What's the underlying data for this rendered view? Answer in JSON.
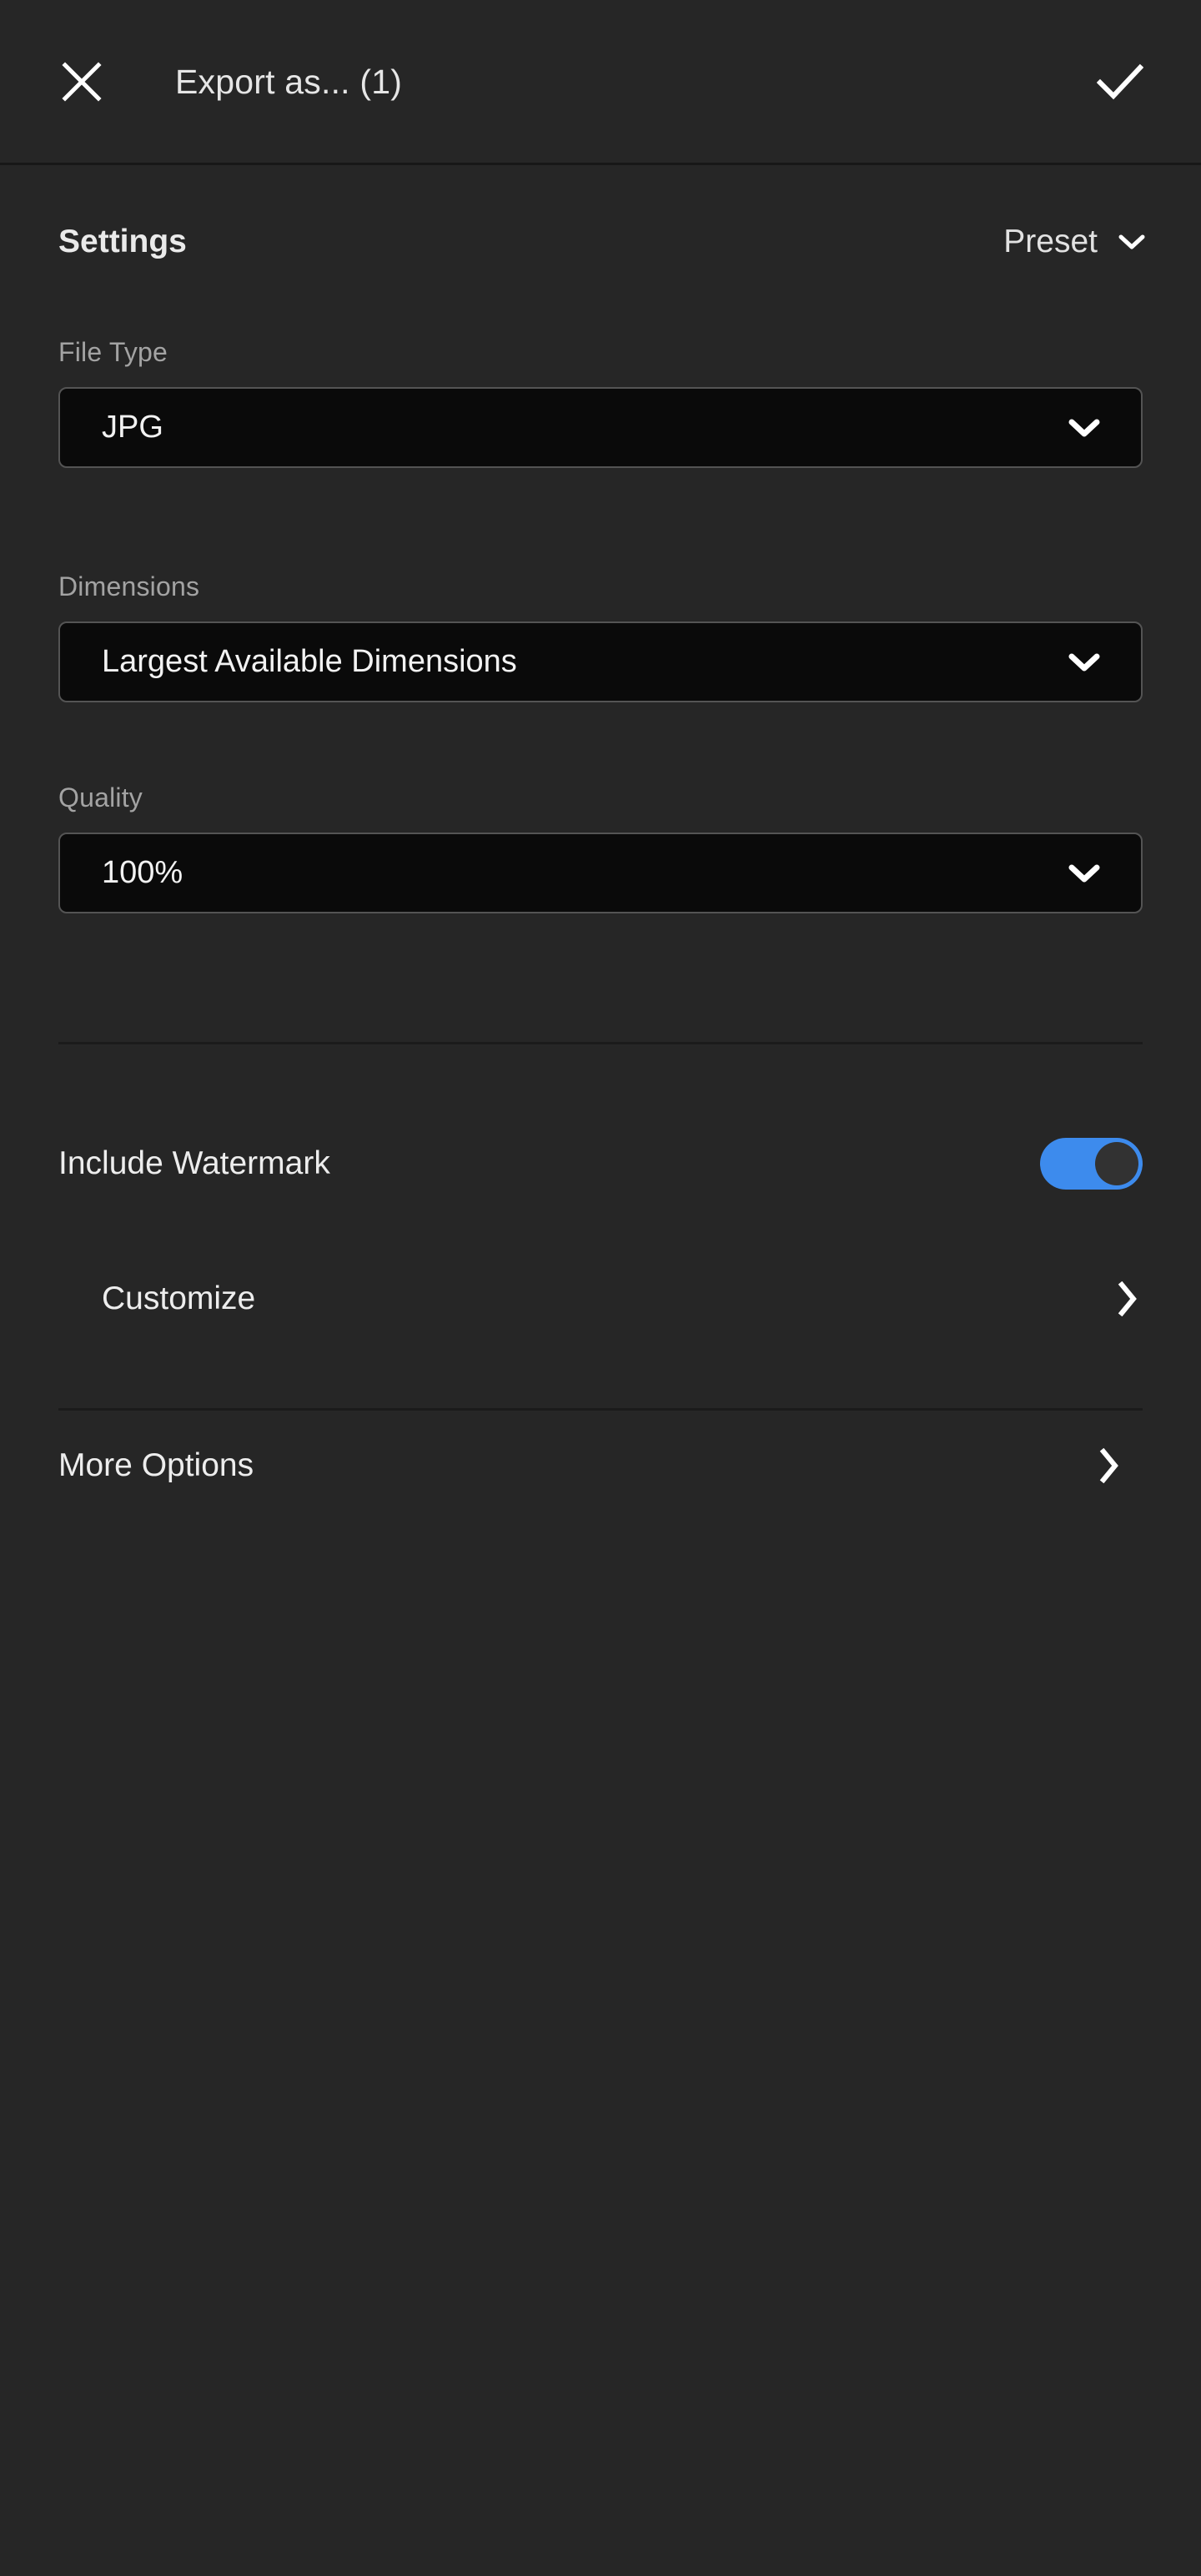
{
  "window": {
    "background_color": "#262626",
    "accent_color": "#3d8bed"
  },
  "titlebar": {
    "close_icon": "close-icon",
    "title": "Export as... (1)",
    "confirm_icon": "check-icon"
  },
  "settings_header": {
    "title": "Settings",
    "preset_label": "Preset",
    "preset_chevron_icon": "chevron-down-icon"
  },
  "fields": {
    "file_type": {
      "label": "File Type",
      "value": "JPG",
      "chevron_icon": "chevron-down-icon"
    },
    "dimensions": {
      "label": "Dimensions",
      "value": "Largest Available Dimensions",
      "chevron_icon": "chevron-down-icon"
    },
    "quality": {
      "label": "Quality",
      "value": "100%",
      "chevron_icon": "chevron-down-icon"
    }
  },
  "watermark": {
    "label": "Include Watermark",
    "enabled": "on",
    "track_color": "#3d8bed",
    "knob_color": "#323232"
  },
  "customize": {
    "label": "Customize",
    "chevron_icon": "chevron-right-icon"
  },
  "more_options": {
    "label": "More Options",
    "chevron_icon": "chevron-right-icon"
  }
}
